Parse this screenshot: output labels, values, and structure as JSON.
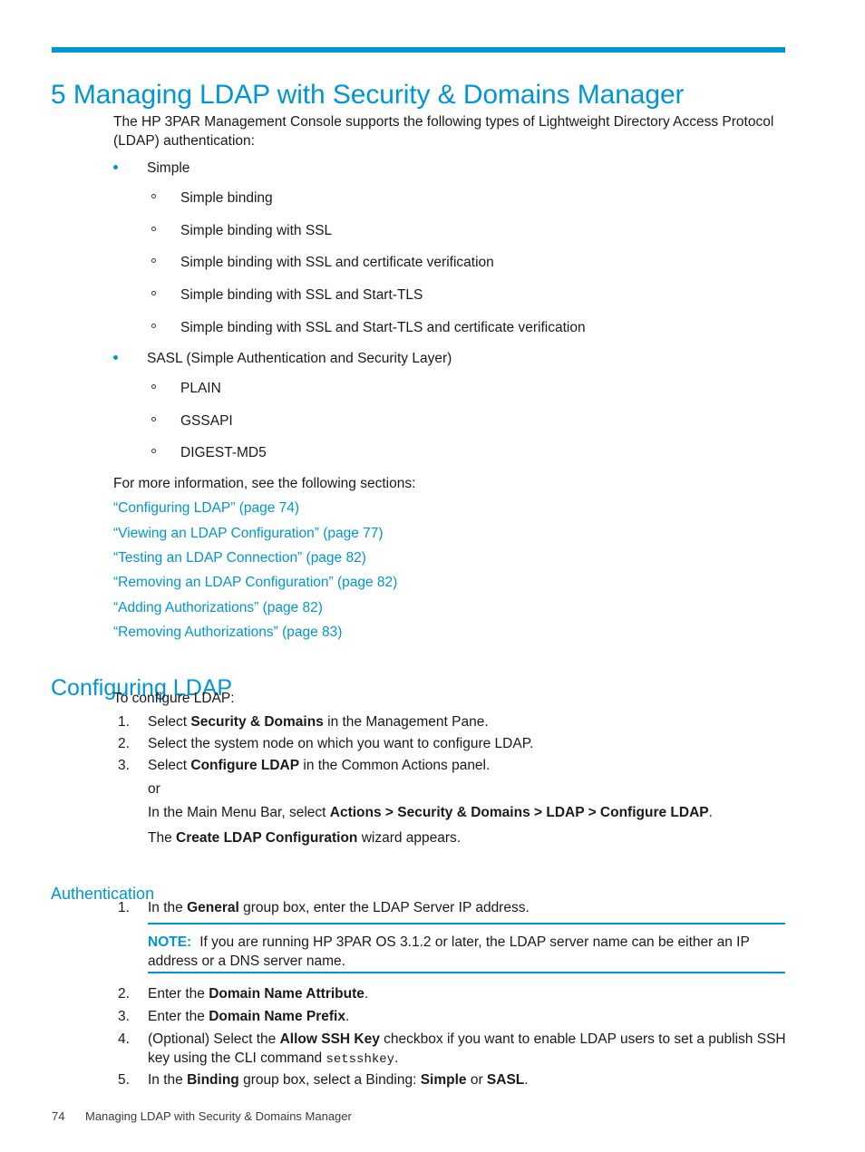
{
  "chapter": {
    "number": "5",
    "title": "5 Managing LDAP with Security & Domains Manager"
  },
  "intro": {
    "paragraph": "The HP 3PAR Management Console supports the following types of Lightweight Directory Access Protocol (LDAP) authentication:"
  },
  "auth_types": [
    {
      "label": "Simple",
      "children": [
        "Simple binding",
        "Simple binding with SSL",
        "Simple binding with SSL and certificate verification",
        "Simple binding with SSL and Start-TLS",
        "Simple binding with SSL and Start-TLS and certificate verification"
      ]
    },
    {
      "label": "SASL (Simple Authentication and Security Layer)",
      "children": [
        "PLAIN",
        "GSSAPI",
        "DIGEST-MD5"
      ]
    }
  ],
  "see_also": {
    "lead_in": "For more information, see the following sections:",
    "links": [
      "“Configuring LDAP” (page 74)",
      "“Viewing an LDAP Configuration” (page 77)",
      "“Testing an LDAP Connection” (page 82)",
      "“Removing an LDAP Configuration” (page 82)",
      "“Adding Authorizations” (page 82)",
      "“Removing Authorizations” (page 83)"
    ]
  },
  "configuring_ldap": {
    "heading": "Configuring LDAP",
    "lead_in": "To configure LDAP:",
    "steps": [
      {
        "num": "1.",
        "pre": "Select ",
        "bold": "Security & Domains",
        "post": " in the Management Pane."
      },
      {
        "num": "2.",
        "pre": "Select the system node on which you want to configure LDAP.",
        "bold": "",
        "post": ""
      },
      {
        "num": "3.",
        "pre": "Select ",
        "bold": "Configure LDAP",
        "post": " in the Common Actions panel."
      }
    ],
    "or_text": "or",
    "menu_path_pre": "In the Main Menu Bar, select ",
    "menu_path_bold": "Actions > Security & Domains > LDAP > Configure LDAP",
    "menu_path_post": ".",
    "wizard_pre": "The ",
    "wizard_bold": "Create LDAP Configuration",
    "wizard_post": " wizard appears."
  },
  "authentication": {
    "heading": "Authentication",
    "steps": [
      {
        "num": "1.",
        "pre": "In the ",
        "bold": "General",
        "post": " group box, enter the LDAP Server IP address."
      },
      {
        "num": "2.",
        "pre": "Enter the ",
        "bold": "Domain Name Attribute",
        "post": "."
      },
      {
        "num": "3.",
        "pre": "Enter the ",
        "bold": "Domain Name Prefix",
        "post": "."
      },
      {
        "num": "4.",
        "pre": "(Optional) Select the ",
        "bold": "Allow SSH Key",
        "post": " checkbox if you want to enable LDAP users to set a publish SSH key using the CLI command ",
        "mono": "setsshkey",
        "tail": "."
      },
      {
        "num": "5.",
        "pre": "In the ",
        "bold": "Binding",
        "mid": " group box, select a Binding: ",
        "bold2": "Simple",
        "mid2": " or ",
        "bold3": "SASL",
        "post": "."
      }
    ],
    "note": {
      "label": "NOTE:",
      "text": "If you are running HP 3PAR OS 3.1.2 or later, the LDAP server name can be either an IP address or a DNS server name."
    }
  },
  "footer": {
    "page_number": "74",
    "running_head": "Managing LDAP with Security & Domains Manager"
  },
  "colors": {
    "accent": "#0096D6",
    "text": "#1A1A1A"
  }
}
